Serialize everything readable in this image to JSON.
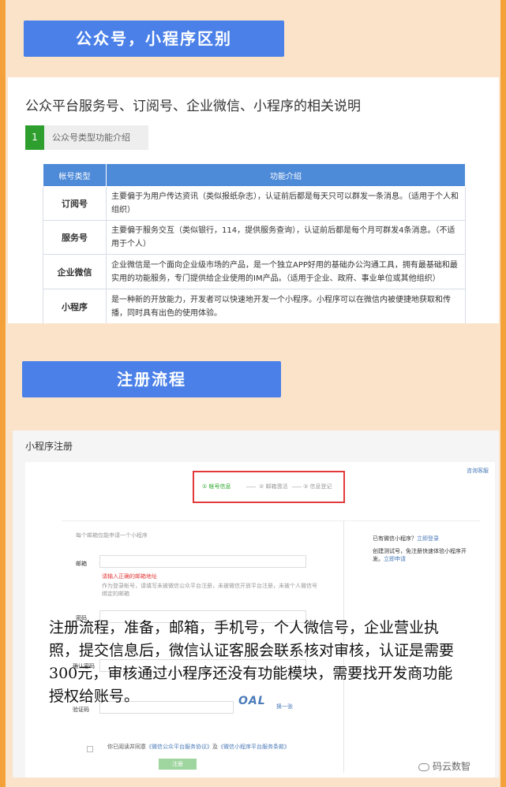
{
  "section1": {
    "button_label": "公众号，小程序区别"
  },
  "panel1": {
    "title": "公众平台服务号、订阅号、企业微信、小程序的相关说明",
    "tag_num": "1",
    "tag_label": "公众号类型功能介绍",
    "table": {
      "headers": [
        "帐号类型",
        "功能介绍"
      ],
      "rows": [
        {
          "type": "订阅号",
          "desc": "主要偏于为用户传达资讯（类似报纸杂志），认证前后都是每天只可以群发一条消息。（适用于个人和组织）"
        },
        {
          "type": "服务号",
          "desc": "主要偏于服务交互（类似银行，114，提供服务查询），认证前后都是每个月可群发4条消息。（不适用于个人）"
        },
        {
          "type": "企业微信",
          "desc": "企业微信是一个面向企业级市场的产品，是一个独立APP好用的基础办公沟通工具，拥有最基础和最实用的功能服务，专门提供给企业使用的IM产品。（适用于企业、政府、事业单位或其他组织）"
        },
        {
          "type": "小程序",
          "desc": "是一种新的开放能力，开发者可以快速地开发一个小程序。小程序可以在微信内被便捷地获取和传播，同时具有出色的使用体验。"
        }
      ]
    }
  },
  "section2": {
    "button_label": "注册流程"
  },
  "panel2": {
    "title": "小程序注册",
    "help_link": "咨询客服",
    "steps": [
      "① 帐号信息",
      "② 邮箱激活",
      "③ 信息登记"
    ],
    "hint": "每个邮箱仅能申请一个小程序",
    "email_label": "邮箱",
    "email_error": "请输入正确的邮箱地址",
    "email_help_1": "作为登录帐号，请填写未被微信公众平台注册，未被微信开放平台注册，未被个人微信号",
    "email_help_2": "绑定的邮箱",
    "password_label": "密码",
    "confirm_label": "确认密码",
    "captcha_label": "验证码",
    "captcha_text": "OAL",
    "refresh_label": "换一张",
    "agree_prefix": "你已阅读并同意",
    "agree_link1": "《微信公众平台服务协议》",
    "agree_and": "及",
    "agree_link2": "《微信小程序平台服务条款》",
    "submit_label": "注册",
    "side_line1": "已有微信小程序？",
    "side_login": "立即登录",
    "side_line2": "创建测试号，免注册快速体验小程序开",
    "side_line3": "发。",
    "side_apply": "立即申请"
  },
  "overlay": {
    "text": "注册流程，准备，邮箱，手机号，个人微信号，企业营业执照，提交信息后，微信认证客服会联系核对审核，认证是需要300元，审核通过小程序还没有功能模块，需要找开发商功能授权给账号。"
  },
  "watermark": {
    "text": "码云数智",
    "icon": "wechat-icon"
  }
}
